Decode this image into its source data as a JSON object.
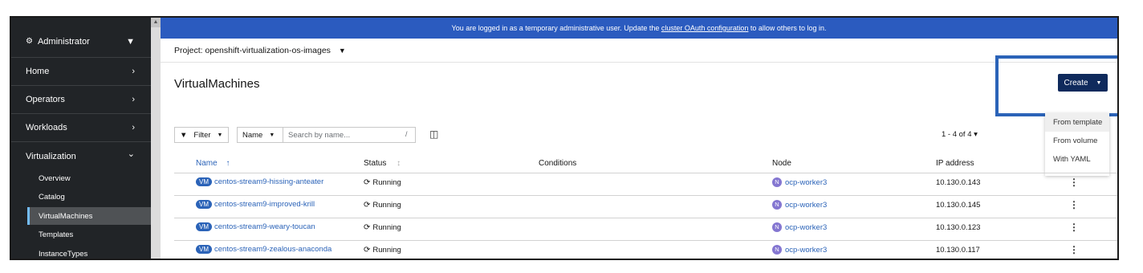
{
  "banner": {
    "prefix": "You are logged in as a temporary administrative user. Update the ",
    "link": "cluster OAuth configuration",
    "suffix": " to allow others to log in."
  },
  "sidebar": {
    "perspective": "Administrator",
    "sections": [
      {
        "label": "Home",
        "chevron": "›"
      },
      {
        "label": "Operators",
        "chevron": "›"
      },
      {
        "label": "Workloads",
        "chevron": "›"
      },
      {
        "label": "Virtualization",
        "chevron": "⌄"
      }
    ],
    "sub_items": [
      "Overview",
      "Catalog",
      "VirtualMachines",
      "Templates",
      "InstanceTypes"
    ]
  },
  "project": {
    "label": "Project: openshift-virtualization-os-images",
    "caret": "▼"
  },
  "page_title": "VirtualMachines",
  "create": {
    "label": "Create",
    "caret": "▼",
    "options": [
      "From template",
      "From volume",
      "With YAML"
    ]
  },
  "toolbar": {
    "filter_label": "Filter",
    "name_select": "Name",
    "search_placeholder": "Search by name...",
    "search_shortcut": "/",
    "pagination": "1 - 4 of 4  ▾"
  },
  "table": {
    "headers": [
      "Name",
      "Status",
      "Conditions",
      "Node",
      "IP address"
    ],
    "sort_indicator": "↑",
    "rows": [
      {
        "name": "centos-stream9-hissing-anteater",
        "status": "Running",
        "node": "ocp-worker3",
        "ip": "10.130.0.143"
      },
      {
        "name": "centos-stream9-improved-krill",
        "status": "Running",
        "node": "ocp-worker3",
        "ip": "10.130.0.145"
      },
      {
        "name": "centos-stream9-weary-toucan",
        "status": "Running",
        "node": "ocp-worker3",
        "ip": "10.130.0.123"
      },
      {
        "name": "centos-stream9-zealous-anaconda",
        "status": "Running",
        "node": "ocp-worker3",
        "ip": "10.130.0.117"
      }
    ],
    "vm_badge": "VM",
    "node_badge": "N"
  },
  "colors": {
    "accent": "#2b63b8",
    "banner": "#2b5bbf",
    "sidebar": "#212427",
    "create_button": "#0f2a5c"
  }
}
